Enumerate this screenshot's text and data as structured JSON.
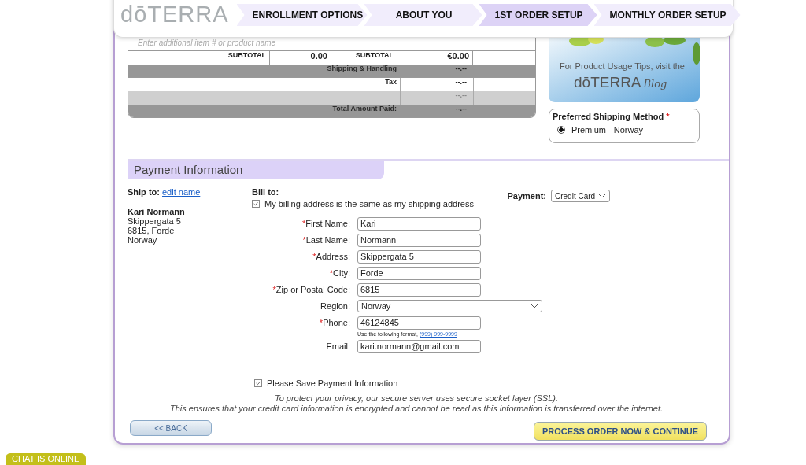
{
  "header": {
    "logo": "dōTERRA",
    "steps": [
      {
        "label": "ENROLLMENT OPTIONS",
        "selected": false
      },
      {
        "label": "ABOUT YOU",
        "selected": false
      },
      {
        "label": "1ST ORDER SETUP",
        "selected": true
      },
      {
        "label": "MONTHLY ORDER SETUP",
        "selected": false
      }
    ]
  },
  "order": {
    "item_placeholder": "Enter additional item # or product name",
    "subtotal_row": [
      "SUBTOTAL",
      "0.00",
      "SUBTOTAL",
      "€0.00"
    ],
    "summary_rows": [
      {
        "kind": "dark",
        "label": "Shipping & Handling",
        "value": "--.--"
      },
      {
        "kind": "white",
        "label": "Tax",
        "value": "--.--"
      },
      {
        "kind": "light",
        "value": "--.--"
      },
      {
        "kind": "dark",
        "label": "Total Amount Paid:",
        "value": "--.--"
      }
    ]
  },
  "promo": {
    "kind": "picture",
    "text": "For Product Usage Tips, visit the",
    "brand": "dōTERRA",
    "blog": "Blog"
  },
  "shipping_method": {
    "title": "Preferred Shipping Method",
    "required_mark": "*",
    "options": [
      {
        "label": "Premium - Norway",
        "selected": true
      }
    ]
  },
  "payment": {
    "title": "Payment Information",
    "ship_to_label": "Ship to:",
    "edit_link": "edit name",
    "address": [
      "Kari Normann",
      "Skippergata 5",
      "6815, Forde",
      "Norway"
    ],
    "bill_to_label": "Bill to:",
    "same_address": {
      "label": "My billing address is the same as my shipping address",
      "checked": true
    },
    "payment_label": "Payment:",
    "payment_method": "Credit Card",
    "fields": [
      {
        "kind": "text",
        "mark": "*",
        "label": "First Name:",
        "value": "Kari"
      },
      {
        "kind": "text",
        "mark": "*",
        "label": "Last Name:",
        "value": "Normann"
      },
      {
        "kind": "text",
        "mark": "*",
        "label": "Address:",
        "value": "Skippergata 5"
      },
      {
        "kind": "text",
        "mark": "*",
        "label": "City:",
        "value": "Forde"
      },
      {
        "kind": "text",
        "mark": "*",
        "label": "Zip or Postal Code:",
        "value": "6815"
      },
      {
        "kind": "select",
        "label": "Region:",
        "value": "Norway"
      },
      {
        "kind": "text",
        "mark": "*",
        "label": "Phone:",
        "value": "46124845",
        "hint": "Use the following format,",
        "hint_link": "(999) 999-9999"
      },
      {
        "kind": "text",
        "label": "Email:",
        "value": "kari.normann@gmail.com"
      }
    ],
    "save_info": {
      "label": "Please Save Payment Information",
      "checked": true
    },
    "notice": [
      "To protect your privacy, our secure server uses secure socket layer (SSL).",
      "This ensures that your credit card information is encrypted and cannot be read as this information is transferred over the internet."
    ],
    "back_button": "<< BACK",
    "continue_button": "PROCESS ORDER NOW & CONTINUE"
  },
  "chat_badge": "CHAT IS ONLINE"
}
